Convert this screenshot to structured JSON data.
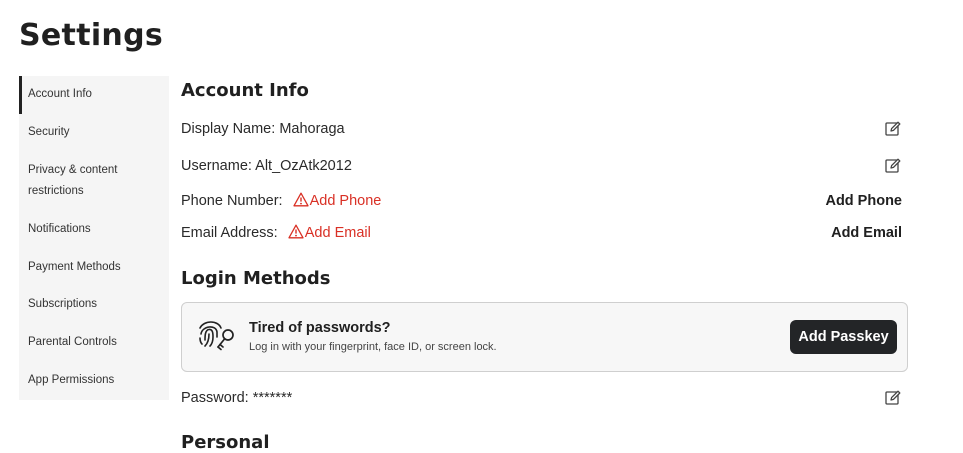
{
  "page": {
    "title": "Settings"
  },
  "sidebar": {
    "items": [
      {
        "label": "Account Info",
        "active": true
      },
      {
        "label": "Security"
      },
      {
        "label": "Privacy & content restrictions"
      },
      {
        "label": "Notifications"
      },
      {
        "label": "Payment Methods"
      },
      {
        "label": "Subscriptions"
      },
      {
        "label": "Parental Controls"
      },
      {
        "label": "App Permissions"
      }
    ]
  },
  "account_info": {
    "title": "Account Info",
    "display_name": {
      "label": "Display Name:",
      "value": "Mahoraga",
      "icon": "edit-icon"
    },
    "username": {
      "label": "Username:",
      "value": "Alt_OzAtk2012",
      "icon": "edit-icon"
    },
    "phone": {
      "label": "Phone Number:",
      "warning": "Add Phone",
      "action": "Add Phone",
      "icon": "warning-icon"
    },
    "email": {
      "label": "Email Address:",
      "warning": "Add Email",
      "action": "Add Email",
      "icon": "warning-icon"
    }
  },
  "login_methods": {
    "title": "Login Methods",
    "passkey": {
      "title": "Tired of passwords?",
      "subtitle": "Log in with your fingerprint, face ID, or screen lock.",
      "button": "Add Passkey",
      "icon": "fingerprint-key-icon"
    },
    "password": {
      "label": "Password:",
      "value": "*******",
      "icon": "edit-icon"
    }
  },
  "next_section": {
    "title": "Personal"
  },
  "colors": {
    "warning": "#d93025",
    "button_bg": "#232527",
    "sidebar_bg": "#f5f5f5"
  }
}
